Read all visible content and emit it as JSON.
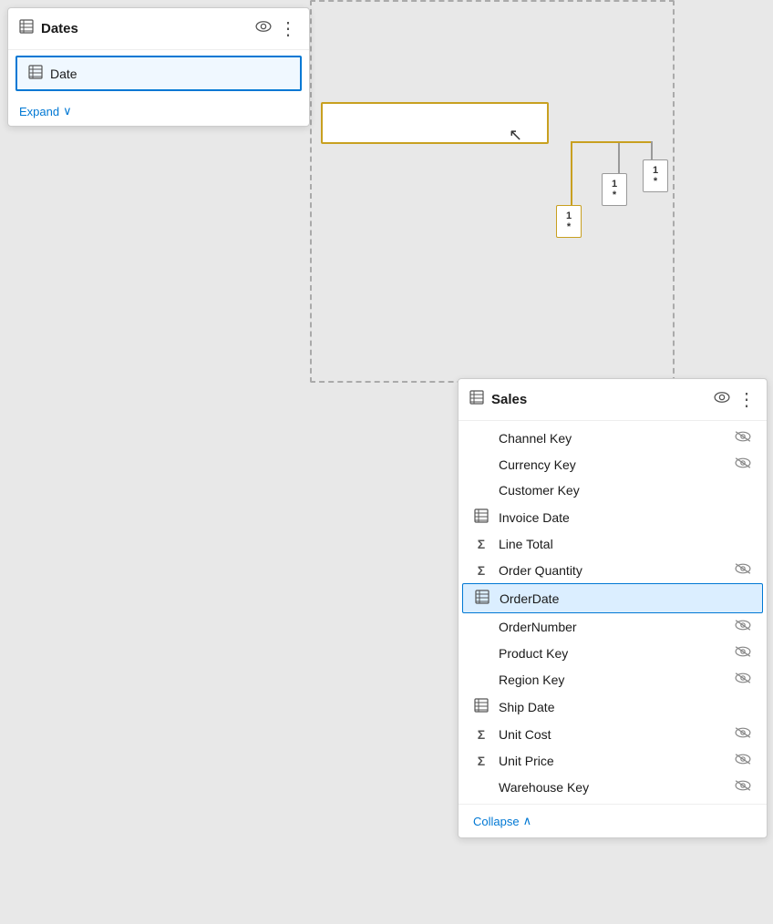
{
  "dates_panel": {
    "title": "Dates",
    "row": {
      "text": "Date",
      "icon": "table-grid"
    },
    "expand_label": "Expand"
  },
  "sales_panel": {
    "title": "Sales",
    "fields": [
      {
        "name": "Channel Key",
        "icon": "none",
        "hidden": true,
        "sigma": false,
        "selected": false
      },
      {
        "name": "Currency Key",
        "icon": "none",
        "hidden": true,
        "sigma": false,
        "selected": false
      },
      {
        "name": "Customer Key",
        "icon": "none",
        "hidden": false,
        "sigma": false,
        "selected": false
      },
      {
        "name": "Invoice Date",
        "icon": "table",
        "hidden": false,
        "sigma": false,
        "selected": false
      },
      {
        "name": "Line Total",
        "icon": "none",
        "hidden": false,
        "sigma": true,
        "selected": false
      },
      {
        "name": "Order Quantity",
        "icon": "none",
        "hidden": true,
        "sigma": true,
        "selected": false
      },
      {
        "name": "OrderDate",
        "icon": "table",
        "hidden": false,
        "sigma": false,
        "selected": true
      },
      {
        "name": "OrderNumber",
        "icon": "none",
        "hidden": true,
        "sigma": false,
        "selected": false
      },
      {
        "name": "Product Key",
        "icon": "none",
        "hidden": true,
        "sigma": false,
        "selected": false
      },
      {
        "name": "Region Key",
        "icon": "none",
        "hidden": true,
        "sigma": false,
        "selected": false
      },
      {
        "name": "Ship Date",
        "icon": "table",
        "hidden": false,
        "sigma": false,
        "selected": false
      },
      {
        "name": "Unit Cost",
        "icon": "none",
        "hidden": true,
        "sigma": true,
        "selected": false
      },
      {
        "name": "Unit Price",
        "icon": "none",
        "hidden": true,
        "sigma": true,
        "selected": false
      },
      {
        "name": "Warehouse Key",
        "icon": "none",
        "hidden": true,
        "sigma": false,
        "selected": false
      }
    ],
    "collapse_label": "Collapse"
  },
  "cardinality": {
    "badge1_top": "1",
    "badge1_bottom": "*",
    "badge2_top": "1",
    "badge2_bottom": "*",
    "badge3_top": "1",
    "badge3_bottom": "*"
  }
}
